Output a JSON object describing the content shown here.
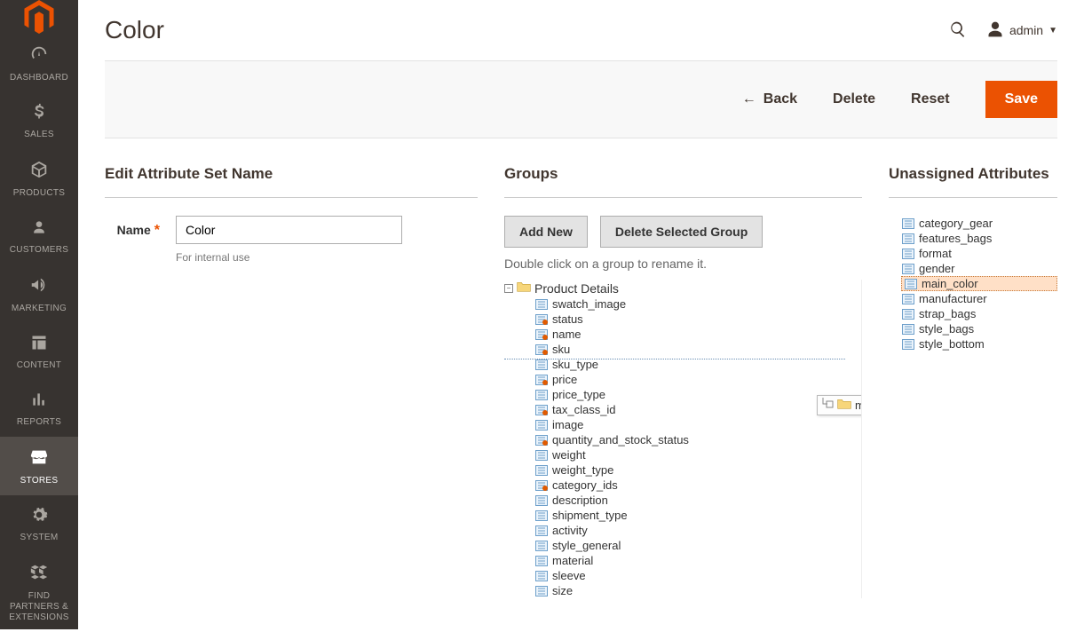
{
  "sidebar": {
    "items": [
      {
        "id": "dashboard",
        "label": "DASHBOARD",
        "icon": "gauge"
      },
      {
        "id": "sales",
        "label": "SALES",
        "icon": "dollar"
      },
      {
        "id": "products",
        "label": "PRODUCTS",
        "icon": "box"
      },
      {
        "id": "customers",
        "label": "CUSTOMERS",
        "icon": "person"
      },
      {
        "id": "marketing",
        "label": "MARKETING",
        "icon": "megaphone"
      },
      {
        "id": "content",
        "label": "CONTENT",
        "icon": "layout"
      },
      {
        "id": "reports",
        "label": "REPORTS",
        "icon": "bars"
      },
      {
        "id": "stores",
        "label": "STORES",
        "icon": "storefront",
        "active": true
      },
      {
        "id": "system",
        "label": "SYSTEM",
        "icon": "gear"
      },
      {
        "id": "partners",
        "label": "FIND PARTNERS & EXTENSIONS",
        "icon": "cubes"
      }
    ]
  },
  "header": {
    "page_title": "Color",
    "user_label": "admin"
  },
  "action_bar": {
    "back_label": "Back",
    "delete_label": "Delete",
    "reset_label": "Reset",
    "save_label": "Save"
  },
  "edit_panel": {
    "title": "Edit Attribute Set Name",
    "name_label": "Name",
    "name_value": "Color",
    "name_note": "For internal use"
  },
  "groups_panel": {
    "title": "Groups",
    "add_new_label": "Add New",
    "delete_group_label": "Delete Selected Group",
    "hint": "Double click on a group to rename it.",
    "root_folder": "Product Details",
    "attributes": [
      {
        "name": "swatch_image",
        "locked": false
      },
      {
        "name": "status",
        "locked": true
      },
      {
        "name": "name",
        "locked": true
      },
      {
        "name": "sku",
        "locked": true
      },
      {
        "name": "sku_type",
        "locked": false
      },
      {
        "name": "price",
        "locked": true
      },
      {
        "name": "price_type",
        "locked": false
      },
      {
        "name": "tax_class_id",
        "locked": true
      },
      {
        "name": "image",
        "locked": false
      },
      {
        "name": "quantity_and_stock_status",
        "locked": true
      },
      {
        "name": "weight",
        "locked": false
      },
      {
        "name": "weight_type",
        "locked": false
      },
      {
        "name": "category_ids",
        "locked": true
      },
      {
        "name": "description",
        "locked": false
      },
      {
        "name": "shipment_type",
        "locked": false
      },
      {
        "name": "activity",
        "locked": false
      },
      {
        "name": "style_general",
        "locked": false
      },
      {
        "name": "material",
        "locked": false
      },
      {
        "name": "sleeve",
        "locked": false
      },
      {
        "name": "size",
        "locked": false
      }
    ]
  },
  "unassigned_panel": {
    "title": "Unassigned Attributes",
    "attributes": [
      {
        "name": "category_gear"
      },
      {
        "name": "features_bags"
      },
      {
        "name": "format"
      },
      {
        "name": "gender"
      },
      {
        "name": "main_color",
        "selected": true
      },
      {
        "name": "manufacturer"
      },
      {
        "name": "strap_bags"
      },
      {
        "name": "style_bags"
      },
      {
        "name": "style_bottom"
      }
    ]
  },
  "drag_ghost": {
    "label": "main_color"
  }
}
